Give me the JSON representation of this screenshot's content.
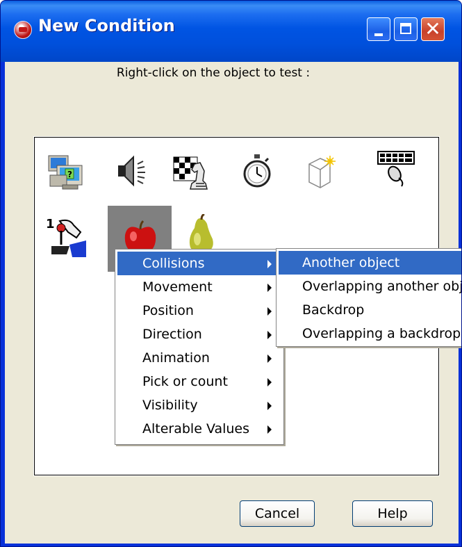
{
  "window": {
    "title": "New Condition",
    "icons": {
      "app": "app-logo-icon",
      "minimize": "minimize-icon",
      "maximize": "maximize-icon",
      "close": "close-icon"
    }
  },
  "dialog": {
    "instruction": "Right-click on the object to test :"
  },
  "objects": [
    {
      "name": "computer-question-icon"
    },
    {
      "name": "speaker-icon"
    },
    {
      "name": "storyboard-chess-icon"
    },
    {
      "name": "stopwatch-icon"
    },
    {
      "name": "new-object-icon"
    },
    {
      "name": "keyboard-mouse-icon"
    },
    {
      "name": "joystick-player-icon",
      "label": "1"
    },
    {
      "name": "apple-icon",
      "selected": true
    },
    {
      "name": "pear-icon"
    }
  ],
  "context_menu": {
    "items": [
      {
        "label": "Collisions",
        "highlighted": true
      },
      {
        "label": "Movement"
      },
      {
        "label": "Position"
      },
      {
        "label": "Direction"
      },
      {
        "label": "Animation"
      },
      {
        "label": "Pick or count"
      },
      {
        "label": "Visibility"
      },
      {
        "label": "Alterable Values"
      }
    ]
  },
  "submenu": {
    "items": [
      {
        "label": "Another object",
        "highlighted": true
      },
      {
        "label": "Overlapping another object"
      },
      {
        "label": "Backdrop"
      },
      {
        "label": "Overlapping a backdrop"
      }
    ]
  },
  "buttons": {
    "cancel": "Cancel",
    "help": "Help"
  },
  "colors": {
    "titlebar": "#0054e3",
    "highlight": "#316ac5",
    "dialog_bg": "#ece9d8"
  }
}
